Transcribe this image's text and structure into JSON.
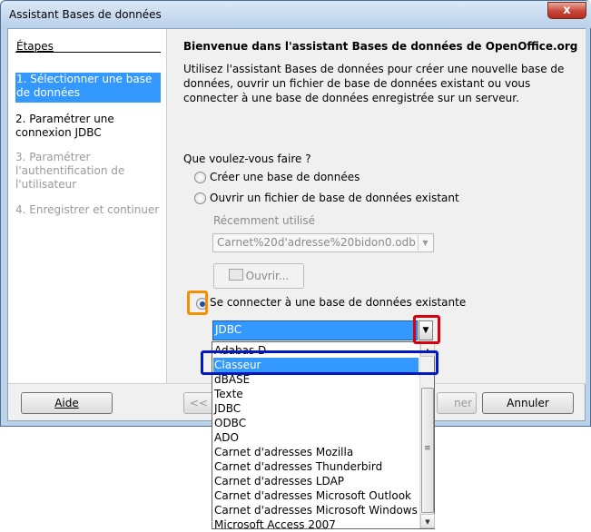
{
  "window": {
    "title": "Assistant Bases de données",
    "close_glyph": "x"
  },
  "steps": {
    "heading": "Étapes",
    "items": [
      {
        "number": "1.",
        "label": "Sélectionner une base de données"
      },
      {
        "number": "2.",
        "label": "Paramétrer une connexion JDBC"
      },
      {
        "number": "3.",
        "label": "Paramétrer l'authentification de l'utilisateur"
      },
      {
        "number": "4.",
        "label": "Enregistrer et continuer"
      }
    ]
  },
  "main": {
    "heading": "Bienvenue dans l'assistant Bases de données de OpenOffice.org",
    "intro": "Utilisez l'assistant Bases de données pour créer une nouvelle base de données, ouvrir un fichier de base de données existant ou vous connecter à une base de données enregistrée sur un serveur.",
    "question": "Que voulez-vous faire ?",
    "option_create": "Créer une base de données",
    "option_open": "Ouvrir un fichier de base de données existant",
    "recent_label": "Récemment utilisé",
    "recent_value": "Carnet%20d'adresse%20bidon0.odb",
    "open_button": "Ouvrir...",
    "option_connect": "Se connecter à une base de données existante",
    "connect_type": "JDBC"
  },
  "buttons": {
    "help": "Aide",
    "back": "<<",
    "finish": "ner",
    "cancel": "Annuler"
  },
  "dropdown": {
    "selected_index": 1,
    "items": [
      "Adabas D",
      "Classeur",
      "dBASE",
      "Texte",
      "JDBC",
      "ODBC",
      "ADO",
      "Carnet d'adresses Mozilla",
      "Carnet d'adresses Thunderbird",
      "Carnet d'adresses LDAP",
      "Carnet d'adresses Microsoft Outlook",
      "Carnet d'adresses Microsoft Windows",
      "Microsoft Access 2007"
    ]
  },
  "icons": {
    "close": "close-icon",
    "dropdown_arrow": "chevron-down-icon",
    "open_folder": "folder-open-icon",
    "scroll_up": "scroll-up-icon",
    "scroll_down": "scroll-down-icon"
  },
  "colors": {
    "selection": "#3399ff",
    "annotation_orange": "#f39000",
    "annotation_red": "#d9000d",
    "annotation_blue": "#0019c5"
  }
}
